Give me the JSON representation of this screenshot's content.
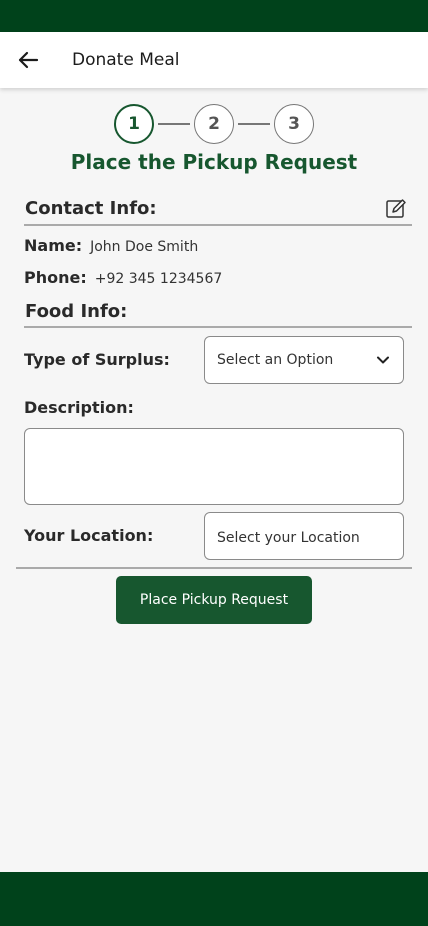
{
  "app_bar": {
    "title": "Donate Meal",
    "back_icon": "arrow-left-icon"
  },
  "stepper": {
    "steps": [
      "1",
      "2",
      "3"
    ],
    "active_step": 1
  },
  "heading": "Place the Pickup Request",
  "contact": {
    "title": "Contact Info:",
    "edit_icon": "edit-icon",
    "name_label": "Name:",
    "name_value": "John Doe Smith",
    "phone_label": "Phone:",
    "phone_value": "+92 345 1234567"
  },
  "food": {
    "title": "Food Info:",
    "surplus_label": "Type of Surplus:",
    "surplus_placeholder": "Select an Option",
    "description_label": "Description:",
    "location_label": "Your Location:",
    "location_placeholder": "Select your Location"
  },
  "submit_label": "Place Pickup Request",
  "colors": {
    "brand_dark": "#00421b",
    "primary": "#17572f",
    "background": "#f6f6f6"
  }
}
